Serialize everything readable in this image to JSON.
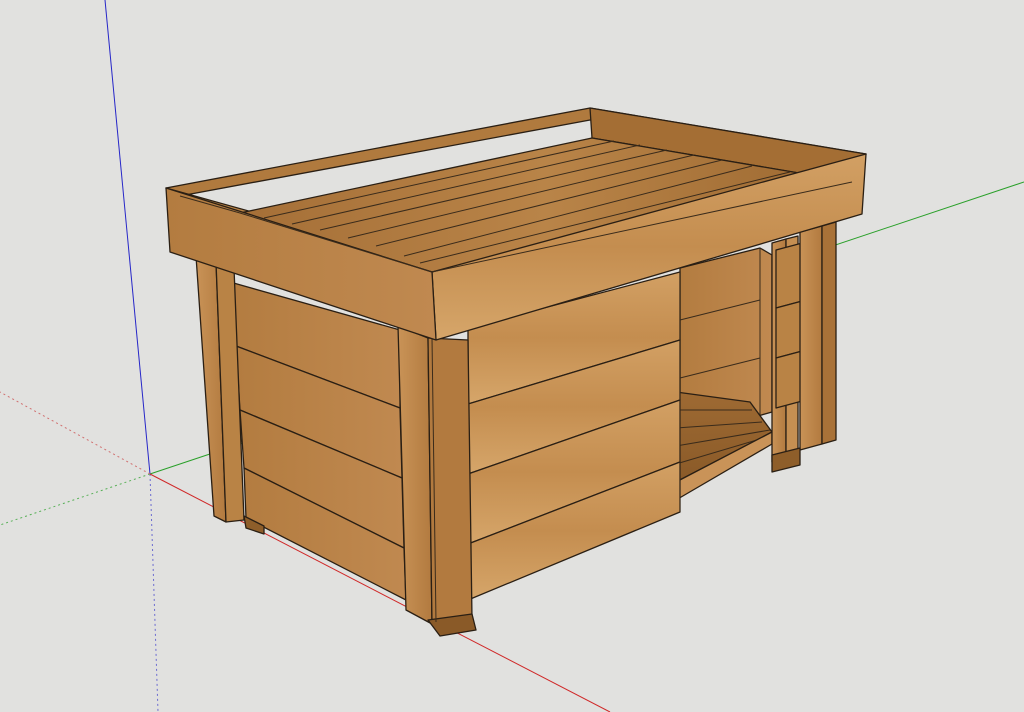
{
  "viewport": {
    "background": "#e1e1df",
    "model": "dog-house",
    "axes": {
      "red": "#d02020",
      "green": "#20a020",
      "blue": "#2020d0"
    },
    "wood": {
      "light": "#c9955a",
      "mid": "#b07a3e",
      "dark": "#8a5a28",
      "shadow": "#6e4520"
    }
  }
}
